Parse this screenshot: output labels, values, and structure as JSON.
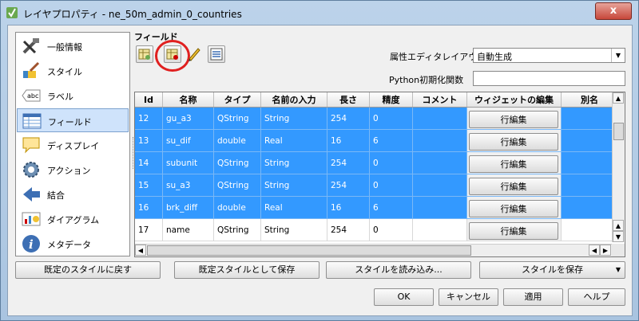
{
  "window": {
    "title": "レイヤプロパティ - ne_50m_admin_0_countries",
    "close_label": "x"
  },
  "sidebar": {
    "items": [
      {
        "label": "一般情報",
        "icon": "tools-icon"
      },
      {
        "label": "スタイル",
        "icon": "brush-icon"
      },
      {
        "label": "ラベル",
        "icon": "abc-label-icon"
      },
      {
        "label": "フィールド",
        "icon": "table-icon"
      },
      {
        "label": "ディスプレイ",
        "icon": "speech-bubble-icon"
      },
      {
        "label": "アクション",
        "icon": "gear-icon"
      },
      {
        "label": "結合",
        "icon": "join-arrow-icon"
      },
      {
        "label": "ダイアグラム",
        "icon": "chart-icon"
      },
      {
        "label": "メタデータ",
        "icon": "info-icon"
      }
    ],
    "selected_index": 3
  },
  "fields": {
    "section_label": "フィールド",
    "layout_label": "属性エディタレイアウト:",
    "layout_value": "自動生成",
    "python_label": "Python初期化関数",
    "python_value": "",
    "columns": [
      "Id",
      "名称",
      "タイプ",
      "名前の入力",
      "長さ",
      "精度",
      "コメント",
      "ウィジェットの編集",
      "別名"
    ],
    "edit_button_label": "行編集",
    "rows": [
      {
        "id": "12",
        "name": "gu_a3",
        "type": "QString",
        "type_name": "String",
        "length": "254",
        "precision": "0",
        "selected": true
      },
      {
        "id": "13",
        "name": "su_dif",
        "type": "double",
        "type_name": "Real",
        "length": "16",
        "precision": "6",
        "selected": true
      },
      {
        "id": "14",
        "name": "subunit",
        "type": "QString",
        "type_name": "String",
        "length": "254",
        "precision": "0",
        "selected": true
      },
      {
        "id": "15",
        "name": "su_a3",
        "type": "QString",
        "type_name": "String",
        "length": "254",
        "precision": "0",
        "selected": true
      },
      {
        "id": "16",
        "name": "brk_diff",
        "type": "double",
        "type_name": "Real",
        "length": "16",
        "precision": "6",
        "selected": true
      },
      {
        "id": "17",
        "name": "name",
        "type": "QString",
        "type_name": "String",
        "length": "254",
        "precision": "0",
        "selected": false
      }
    ]
  },
  "bottom_bar": {
    "restore_default": "既定のスタイルに戻す",
    "save_as_default": "既定スタイルとして保存",
    "load_style": "スタイルを読み込み...",
    "save_style": "スタイルを保存"
  },
  "dialog_buttons": {
    "ok": "OK",
    "cancel": "キャンセル",
    "apply": "適用",
    "help": "ヘルプ"
  }
}
